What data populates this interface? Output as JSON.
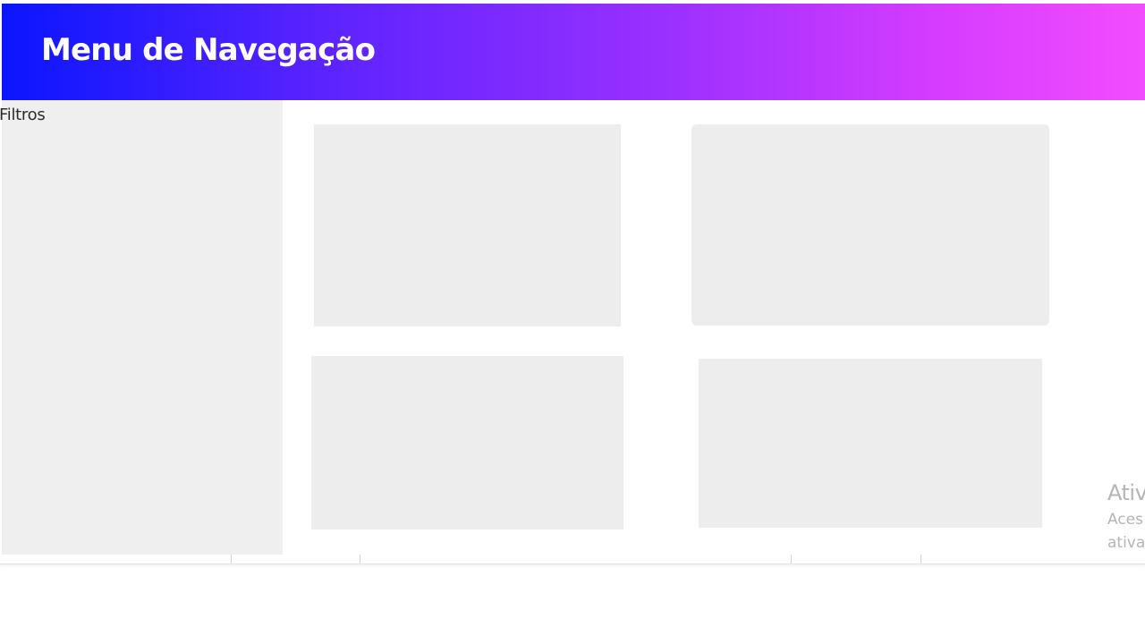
{
  "header": {
    "title": "Menu de Navegação",
    "gradient": [
      "#0a16ff",
      "#5b23ff",
      "#9a30ff",
      "#d63cff",
      "#f24cff"
    ]
  },
  "sidebar": {
    "title": "Filtros",
    "background": "#efefef"
  },
  "main": {
    "cards": [
      {
        "background": "#ededed"
      },
      {
        "background": "#ededed"
      },
      {
        "background": "#ededed"
      },
      {
        "background": "#ededed"
      }
    ]
  },
  "watermark": {
    "title": "Ativ",
    "line1": "Aces",
    "line2": "ativa"
  }
}
